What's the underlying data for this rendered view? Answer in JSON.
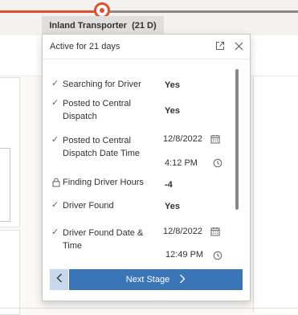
{
  "process": {
    "active_stage_name": "Inland Transporter",
    "active_stage_days": "(21 D)"
  },
  "flyout": {
    "title": "Active for 21 days",
    "icons": {
      "expand": "expand-icon",
      "close": "close-icon"
    },
    "fields": [
      {
        "label": "Searching for Driver",
        "value": "Yes",
        "status": "check"
      },
      {
        "label": "Posted to Central Dispatch",
        "value": "Yes",
        "status": "check"
      },
      {
        "label": "Posted to Central Dispatch Date Time",
        "date": "12/8/2022",
        "time": "4:12 PM",
        "status": "check"
      },
      {
        "label": "Finding Driver Hours",
        "value": "-4",
        "status": "lock"
      },
      {
        "label": "Driver Found",
        "value": "Yes",
        "status": "check"
      },
      {
        "label": "Driver Found Date & Time",
        "date": "12/8/2022",
        "time": "12:49 PM",
        "status": "check"
      }
    ],
    "prev_label": "<",
    "next_label": "Next Stage",
    "next_chevron": ">"
  },
  "colors": {
    "active_stage": "#e04e2d",
    "next_button": "#3a75b8",
    "prev_button": "#c7d7ec"
  }
}
